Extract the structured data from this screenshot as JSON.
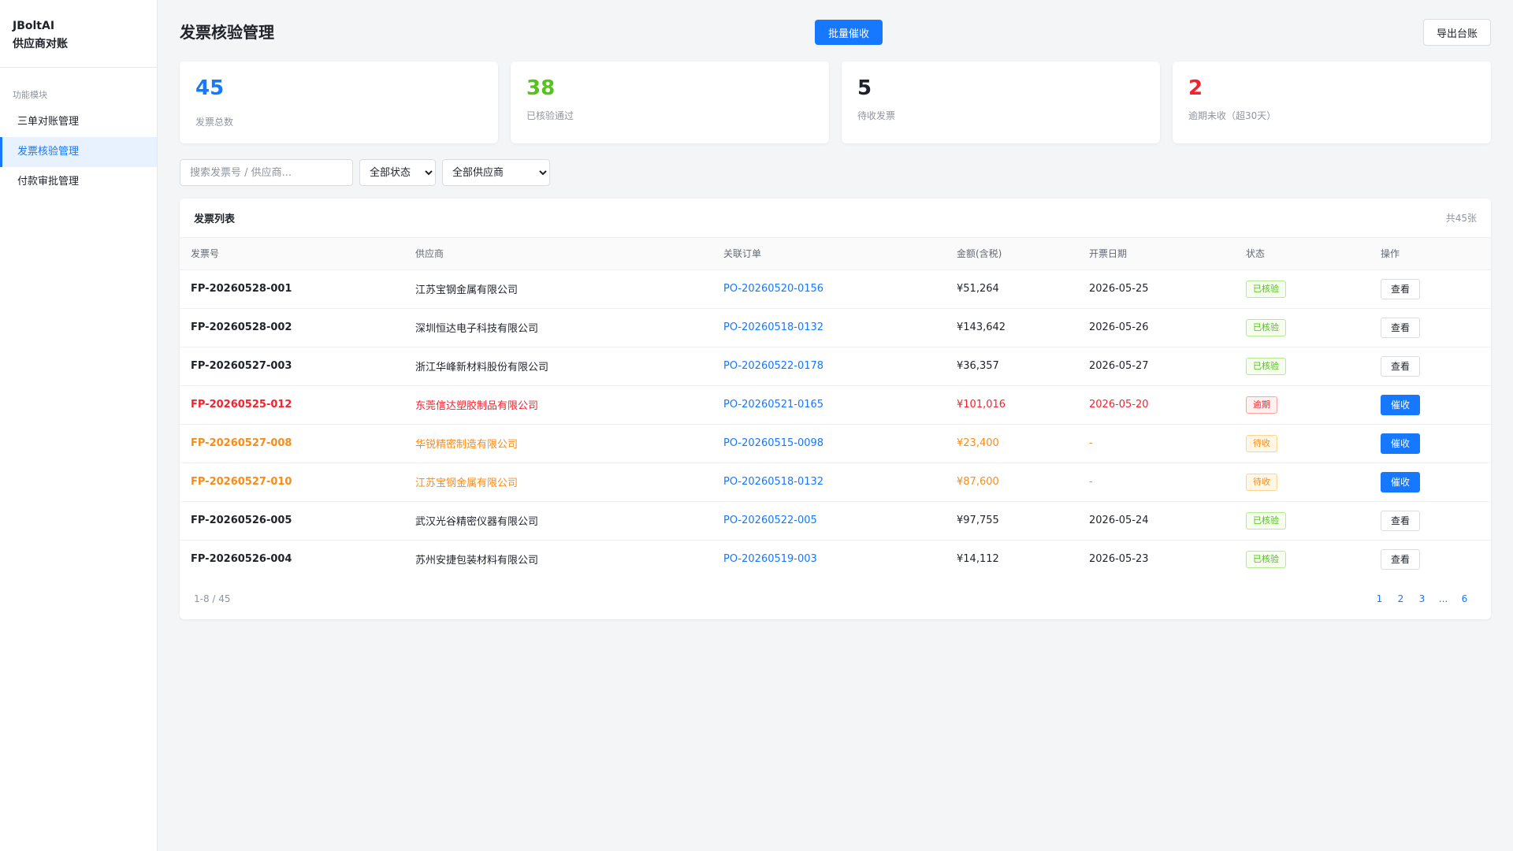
{
  "brand": {
    "line1": "JBoltAI",
    "line2": "供应商对账"
  },
  "nav": {
    "section": "功能模块",
    "items": [
      {
        "label": "三单对账管理",
        "active": false
      },
      {
        "label": "发票核验管理",
        "active": true
      },
      {
        "label": "付款审批管理",
        "active": false
      }
    ]
  },
  "header": {
    "title": "发票核验管理",
    "batch_button": "批量催收",
    "export_button": "导出台账"
  },
  "stats": [
    {
      "value": "45",
      "label": "发票总数",
      "color": "#1677ff"
    },
    {
      "value": "38",
      "label": "已核验通过",
      "color": "#52c41a"
    },
    {
      "value": "5",
      "label": "待收发票",
      "color": "#1f2329"
    },
    {
      "value": "2",
      "label": "逾期未收（超30天）",
      "color": "#f5222d"
    }
  ],
  "filters": {
    "search_placeholder": "搜索发票号 / 供应商...",
    "status_selected": "全部状态",
    "supplier_selected": "全部供应商"
  },
  "table": {
    "title": "发票列表",
    "count": "共45张",
    "columns": [
      "发票号",
      "供应商",
      "关联订单",
      "金额(含税)",
      "开票日期",
      "状态",
      "操作"
    ],
    "rows": [
      {
        "invoice": "FP-20260528-001",
        "supplier": "江苏宝钢金属有限公司",
        "po": "PO-20260520-0156",
        "amount": "¥51,264",
        "date": "2026-05-25",
        "status": "已核验",
        "state": "ok",
        "action": "查看"
      },
      {
        "invoice": "FP-20260528-002",
        "supplier": "深圳恒达电子科技有限公司",
        "po": "PO-20260518-0132",
        "amount": "¥143,642",
        "date": "2026-05-26",
        "status": "已核验",
        "state": "ok",
        "action": "查看"
      },
      {
        "invoice": "FP-20260527-003",
        "supplier": "浙江华峰新材料股份有限公司",
        "po": "PO-20260522-0178",
        "amount": "¥36,357",
        "date": "2026-05-27",
        "status": "已核验",
        "state": "ok",
        "action": "查看"
      },
      {
        "invoice": "FP-20260525-012",
        "supplier": "东莞信达塑胶制品有限公司",
        "po": "PO-20260521-0165",
        "amount": "¥101,016",
        "date": "2026-05-20",
        "status": "逾期",
        "state": "overdue",
        "action": "催收"
      },
      {
        "invoice": "FP-20260527-008",
        "supplier": "华锐精密制造有限公司",
        "po": "PO-20260515-0098",
        "amount": "¥23,400",
        "date": "-",
        "status": "待收",
        "state": "pending",
        "action": "催收"
      },
      {
        "invoice": "FP-20260527-010",
        "supplier": "江苏宝钢金属有限公司",
        "po": "PO-20260518-0132",
        "amount": "¥87,600",
        "date": "-",
        "status": "待收",
        "state": "pending",
        "action": "催收"
      },
      {
        "invoice": "FP-20260526-005",
        "supplier": "武汉光谷精密仪器有限公司",
        "po": "PO-20260522-005",
        "amount": "¥97,755",
        "date": "2026-05-24",
        "status": "已核验",
        "state": "ok",
        "action": "查看"
      },
      {
        "invoice": "FP-20260526-004",
        "supplier": "苏州安捷包装材料有限公司",
        "po": "PO-20260519-003",
        "amount": "¥14,112",
        "date": "2026-05-23",
        "status": "已核验",
        "state": "ok",
        "action": "查看"
      }
    ]
  },
  "pagination": {
    "range": "1-8 / 45",
    "pages": [
      "1",
      "2",
      "3",
      "...",
      "6"
    ]
  }
}
